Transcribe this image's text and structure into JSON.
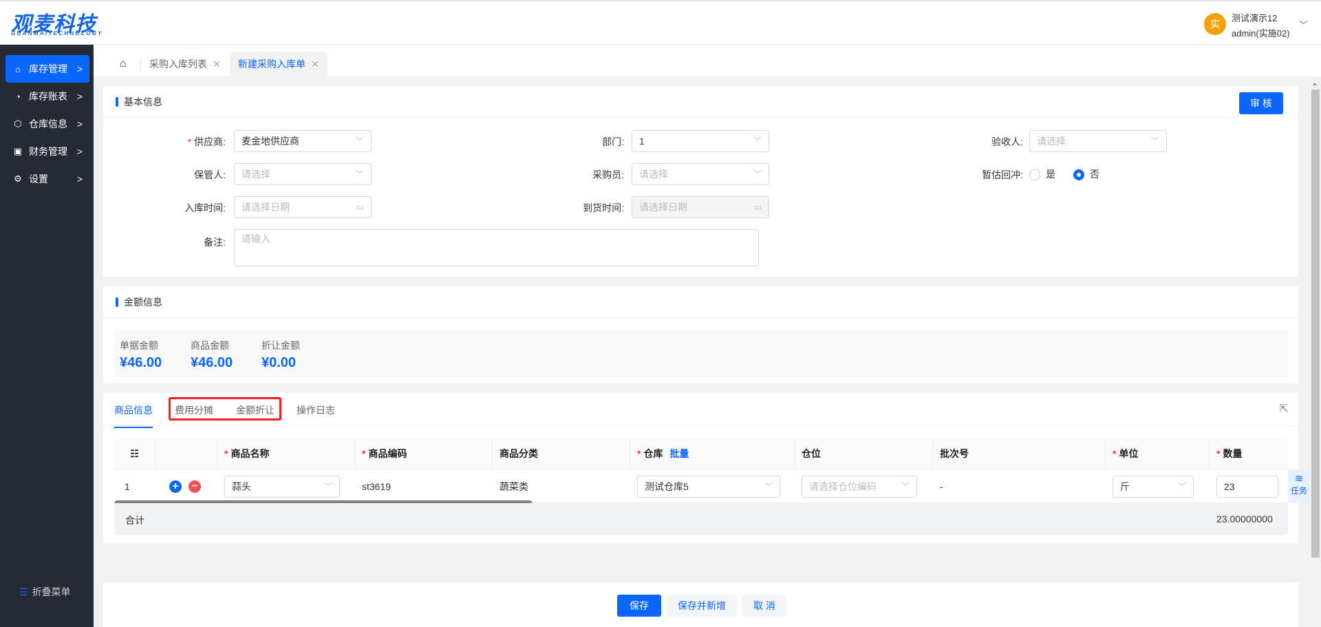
{
  "header": {
    "logo": "观麦科技",
    "logo_sub": "GUANMAITECHNOLOGY",
    "avatar": "实",
    "user_name": "测试演示12",
    "user_account": "admin(实施02)"
  },
  "sidebar": {
    "items": [
      {
        "label": "库存管理",
        "icon": "home-icon"
      },
      {
        "label": "库存账表",
        "icon": "pie-chart-icon"
      },
      {
        "label": "仓库信息",
        "icon": "cube-icon"
      },
      {
        "label": "财务管理",
        "icon": "finance-icon"
      },
      {
        "label": "设置",
        "icon": "gear-icon"
      }
    ],
    "collapse": "折叠菜单"
  },
  "tabs": [
    {
      "label": "采购入库列表"
    },
    {
      "label": "新建采购入库单"
    }
  ],
  "basic": {
    "title": "基本信息",
    "audit": "审 核",
    "supplier_label": "供应商:",
    "supplier": "麦金地供应商",
    "dept_label": "部门:",
    "dept": "1",
    "receiver_label": "验收人:",
    "receiver_ph": "请选择",
    "keeper_label": "保管人:",
    "keeper_ph": "请选择",
    "buyer_label": "采购员:",
    "buyer_ph": "请选择",
    "reverse_label": "暂估回冲:",
    "yes": "是",
    "no": "否",
    "in_time_label": "入库时间:",
    "in_time_ph": "请选择日期",
    "arrive_label": "到货时间:",
    "arrive_ph": "请选择日期",
    "remark_label": "备注:",
    "remark_ph": "请输入"
  },
  "amount": {
    "title": "金额信息",
    "items": [
      {
        "label": "单据金额",
        "value": "¥46.00"
      },
      {
        "label": "商品金额",
        "value": "¥46.00"
      },
      {
        "label": "折让金额",
        "value": "¥0.00"
      }
    ]
  },
  "goods": {
    "tabs": [
      "商品信息",
      "费用分摊",
      "金额折让",
      "操作日志"
    ],
    "columns": [
      "商品名称",
      "商品编码",
      "商品分类",
      "仓库",
      "仓位",
      "批次号",
      "单位",
      "数量"
    ],
    "batch": "批量",
    "row": {
      "index": "1",
      "name": "蒜头",
      "code": "st3619",
      "category": "蔬菜类",
      "warehouse": "测试仓库5",
      "location_ph": "请选择仓位编码",
      "batch_no": "-",
      "unit": "斤",
      "qty": "23"
    },
    "total_label": "合计",
    "total_qty": "23.00000000",
    "task": "任务"
  },
  "footer": {
    "save": "保存",
    "save_new": "保存并新增",
    "cancel": "取 消"
  },
  "colors": {
    "primary": "#0a66ff",
    "sidebar": "#262a35",
    "avatar": "#f5a00f",
    "highlight": "#ff1a1a"
  }
}
